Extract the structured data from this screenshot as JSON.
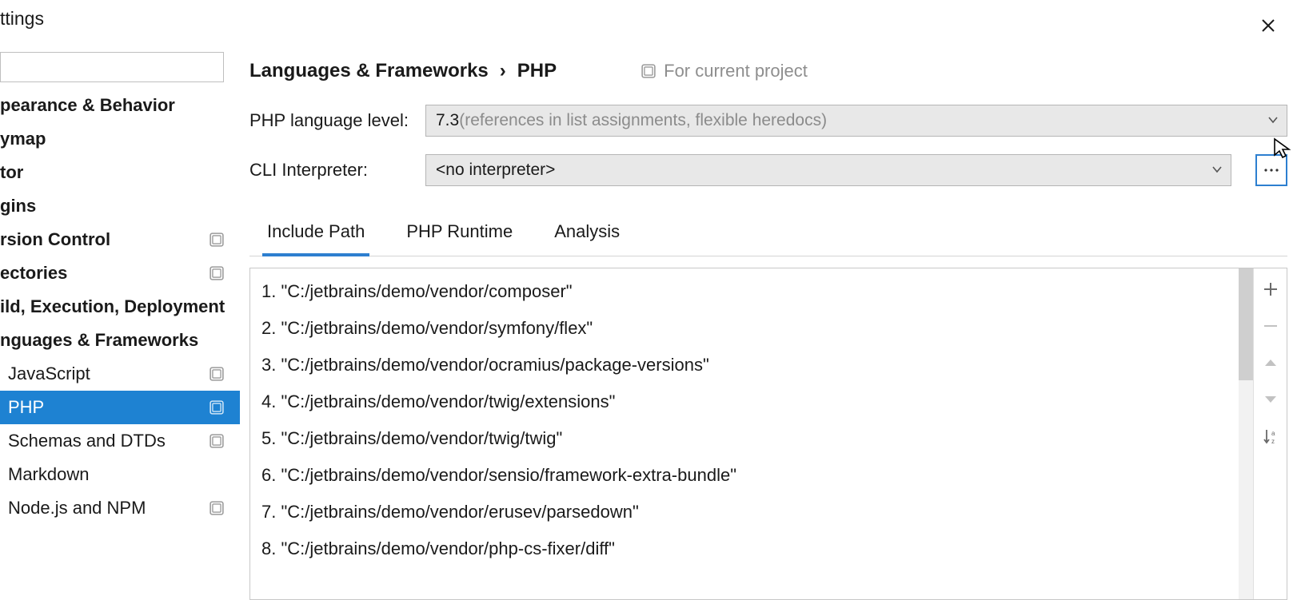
{
  "windowTitle": "ttings",
  "breadcrumb": {
    "group": "Languages & Frameworks",
    "page": "PHP"
  },
  "scopeNote": "For current project",
  "form": {
    "langLevel": {
      "label": "PHP language level:",
      "value": "7.3",
      "hint": " (references in list assignments, flexible heredocs)"
    },
    "cli": {
      "label": "CLI Interpreter:",
      "value": "<no interpreter>"
    }
  },
  "tabs": {
    "include": "Include Path",
    "runtime": "PHP Runtime",
    "analysis": "Analysis"
  },
  "sidebar": [
    {
      "label": "pearance & Behavior",
      "bold": true
    },
    {
      "label": "ymap",
      "bold": true
    },
    {
      "label": "tor",
      "bold": true
    },
    {
      "label": "gins",
      "bold": true
    },
    {
      "label": "rsion Control",
      "bold": true,
      "scope": true
    },
    {
      "label": "ectories",
      "bold": true,
      "scope": true
    },
    {
      "label": "ild, Execution, Deployment",
      "bold": true
    },
    {
      "label": "nguages & Frameworks",
      "bold": true
    },
    {
      "label": "JavaScript",
      "child": true,
      "scope": true
    },
    {
      "label": "PHP",
      "child": true,
      "scope": true,
      "selected": true
    },
    {
      "label": "Schemas and DTDs",
      "child": true,
      "scope": true
    },
    {
      "label": "Markdown",
      "child": true
    },
    {
      "label": "Node.js and NPM",
      "child": true,
      "scope": true
    }
  ],
  "includePaths": [
    "1. \"C:/jetbrains/demo/vendor/composer\"",
    "2. \"C:/jetbrains/demo/vendor/symfony/flex\"",
    "3. \"C:/jetbrains/demo/vendor/ocramius/package-versions\"",
    "4. \"C:/jetbrains/demo/vendor/twig/extensions\"",
    "5. \"C:/jetbrains/demo/vendor/twig/twig\"",
    "6. \"C:/jetbrains/demo/vendor/sensio/framework-extra-bundle\"",
    "7. \"C:/jetbrains/demo/vendor/erusev/parsedown\"",
    "8. \"C:/jetbrains/demo/vendor/php-cs-fixer/diff\""
  ]
}
